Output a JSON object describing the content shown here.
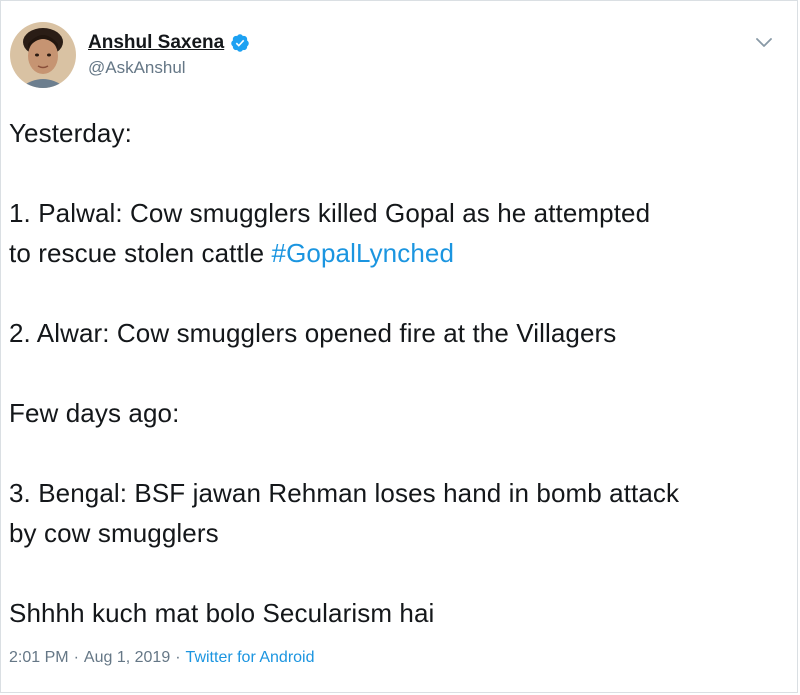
{
  "tweet": {
    "author": {
      "display_name": "Anshul Saxena",
      "handle": "@AskAnshul",
      "verified": true,
      "avatar_icon": "user-photo-avatar"
    },
    "menu_icon": "chevron-down-icon",
    "lines": {
      "l1": "Yesterday:",
      "l2a": "1. Palwal: Cow smugglers killed Gopal as he attempted",
      "l2b": "to rescue stolen cattle ",
      "hashtag": "#GopalLynched",
      "l3": "2. Alwar: Cow smugglers opened fire at the Villagers",
      "l4": "Few days ago:",
      "l5a": "3. Bengal: BSF jawan Rehman loses hand in bomb attack",
      "l5b": "by cow smugglers",
      "l6": "Shhhh kuch mat bolo Secularism hai"
    },
    "meta": {
      "time": "2:01 PM",
      "sep1": "·",
      "date": "Aug 1, 2019",
      "sep2": "·",
      "source": "Twitter for Android"
    },
    "colors": {
      "link": "#1b95e0",
      "text": "#14171a",
      "muted": "#657786"
    }
  }
}
